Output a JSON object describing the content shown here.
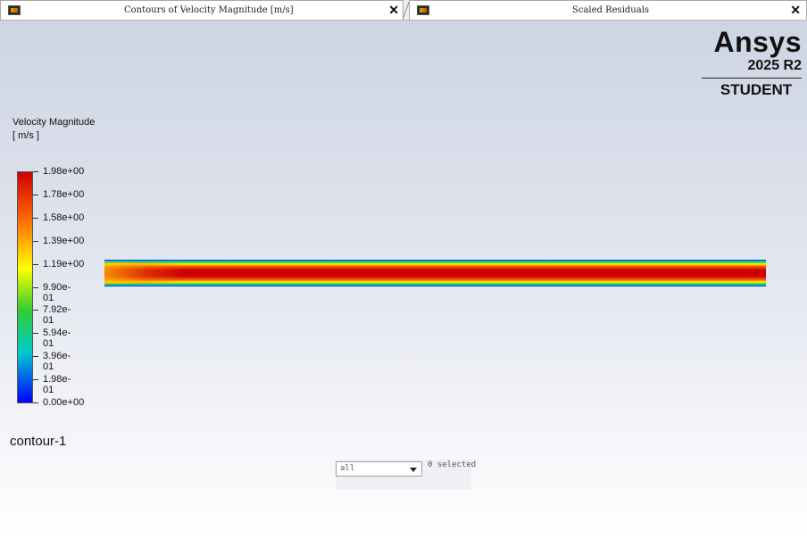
{
  "tabs": [
    {
      "title": "Contours of Velocity Magnitude [m/s]",
      "close": "✕"
    },
    {
      "title": "Scaled Residuals",
      "close": "✕"
    }
  ],
  "logo": {
    "brand": "Ansys",
    "version": "2025 R2",
    "edition": "STUDENT"
  },
  "legend": {
    "title_line1": "Velocity Magnitude",
    "title_line2": "[ m/s ]",
    "labels": [
      "1.98e+00",
      "1.78e+00",
      "1.58e+00",
      "1.39e+00",
      "1.19e+00",
      "9.90e-01",
      "7.92e-01",
      "5.94e-01",
      "3.96e-01",
      "1.98e-01",
      "0.00e+00"
    ]
  },
  "contour_name": "contour-1",
  "selection": {
    "value": "all",
    "count_text": "0 selected"
  },
  "colors": {
    "max": "#cc0000",
    "high": "#ff6600",
    "mid": "#ffff00",
    "midlow": "#33cc33",
    "low": "#00cccc",
    "min": "#0000ff"
  }
}
